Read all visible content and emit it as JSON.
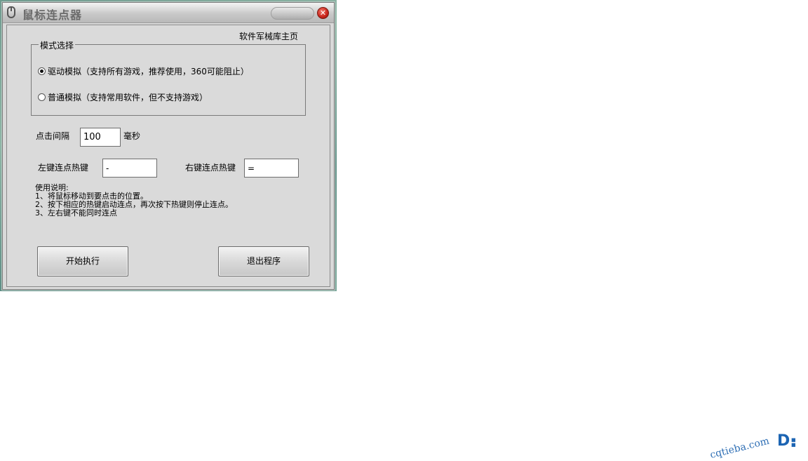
{
  "window": {
    "title": "鼠标连点器",
    "close_glyph": "✕"
  },
  "header": {
    "home_link": "软件军械库主页"
  },
  "mode": {
    "group_label": "模式选择",
    "options": [
      {
        "label": "驱动模拟（支持所有游戏，推荐使用，360可能阻止）",
        "selected": true
      },
      {
        "label": "普通模拟（支持常用软件，但不支持游戏）",
        "selected": false
      }
    ]
  },
  "interval": {
    "label": "点击间隔",
    "value": "100",
    "unit": "毫秒"
  },
  "hotkeys": {
    "left_label": "左键连点热键",
    "left_value": "-",
    "right_label": "右键连点热键",
    "right_value": "="
  },
  "instructions": {
    "title": "使用说明:",
    "lines": [
      "1、将鼠标移动到要点击的位置。",
      "2、按下相应的热键启动连点，再次按下热键则停止连点。",
      "3、左右键不能同时连点"
    ]
  },
  "buttons": {
    "start": "开始执行",
    "exit": "退出程序"
  },
  "watermark": {
    "text": "cqtieba.com"
  },
  "icons": {
    "title": "mouse-icon",
    "close": "close-icon",
    "logo": "site-logo-icon"
  },
  "colors": {
    "close": "#c8231a",
    "watermark": "#2f6fb5"
  }
}
